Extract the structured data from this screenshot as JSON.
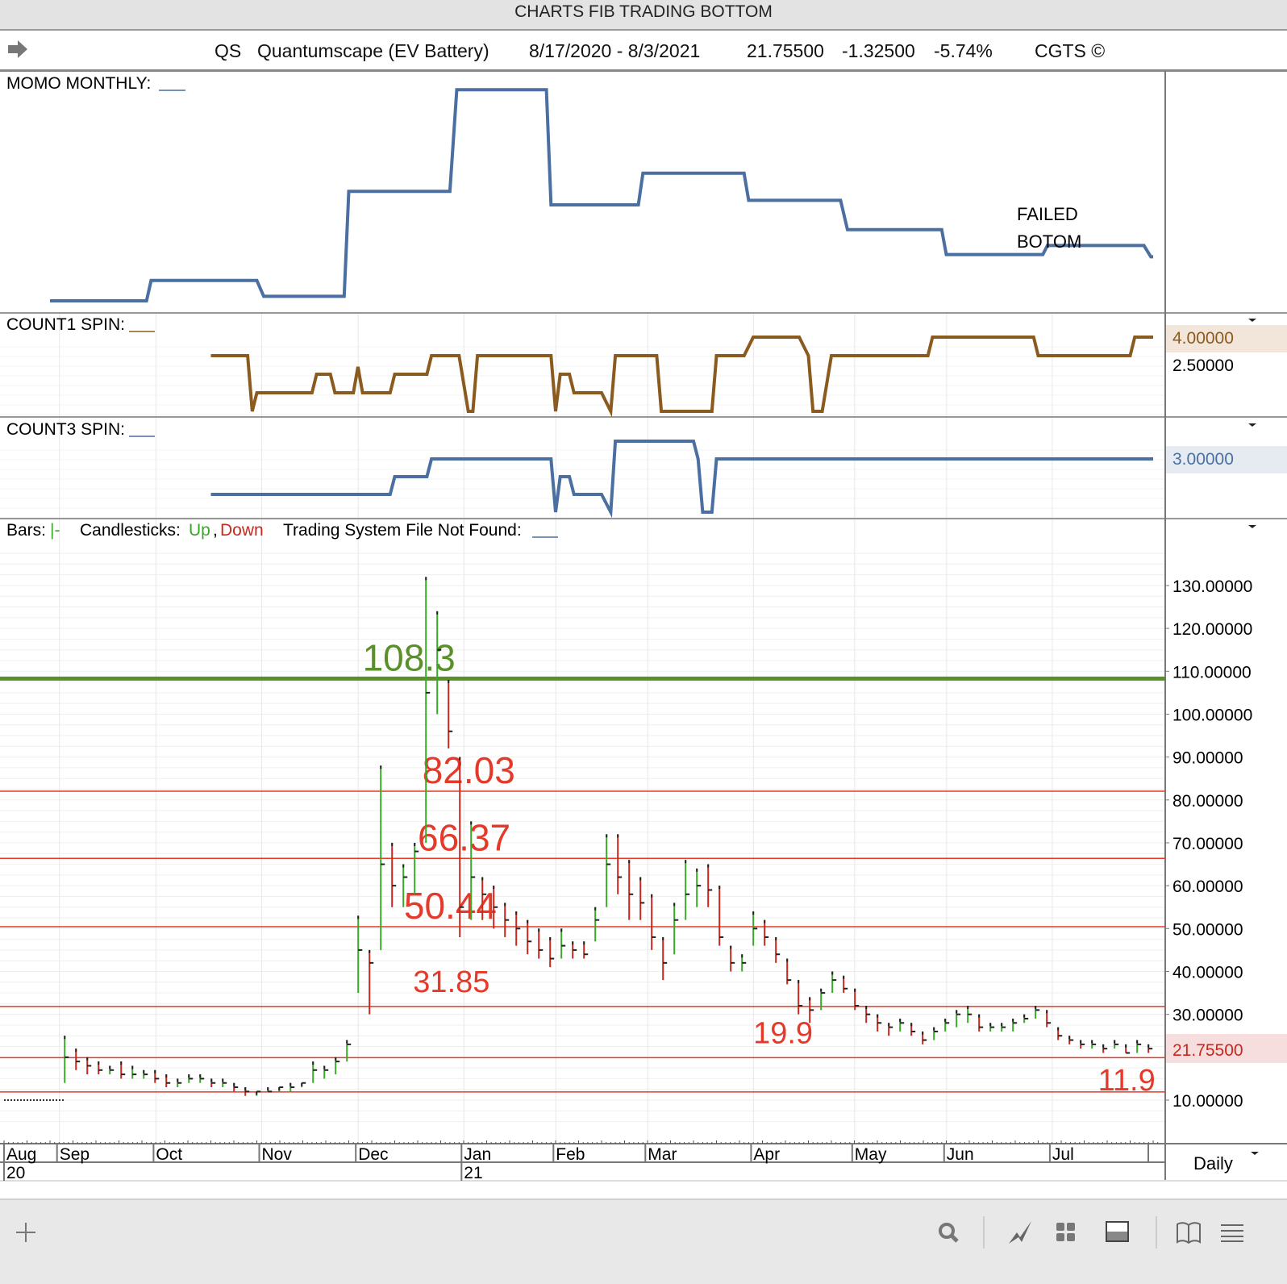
{
  "window_title": "CHARTS FIB TRADING BOTTOM",
  "info": {
    "symbol": "QS",
    "name": "Quantumscape (EV Battery)",
    "date_range": "8/17/2020 - 8/3/2021",
    "last": "21.75500",
    "change": "-1.32500",
    "change_pct": "-5.74%",
    "copyright": "CGTS ©"
  },
  "panels": {
    "momo": {
      "label": "MOMO MONTHLY:",
      "annotation_1": "FAILED",
      "annotation_2": "BOTOM",
      "color": "#4a6fa0"
    },
    "count1": {
      "label": "COUNT1 SPIN:",
      "axis_top": "4.00000",
      "axis_mid": "2.50000",
      "color": "#8b5a1e"
    },
    "count3": {
      "label": "COUNT3 SPIN:",
      "axis_top": "3.00000",
      "color": "#4a6fa0"
    },
    "price": {
      "bars_label": "Bars:",
      "bars_marker": "|-",
      "candles_label": "Candlesticks:",
      "up": "Up",
      "comma": ",",
      "down": "Down",
      "system_label": "Trading System File Not Found:",
      "current_price": "21.75500",
      "period": "Daily"
    }
  },
  "colors": {
    "up": "#3aa829",
    "down": "#c8281e",
    "fib_red": "#e53a2a",
    "fib_green": "#5a8f2a",
    "line_blue": "#4a6fa0",
    "line_brown": "#8b5a1e"
  },
  "chart_data": {
    "type": "bar",
    "x_unit": "trading day since 8/17/2020",
    "x_range": [
      0,
      252
    ],
    "price_ylim": [
      0,
      140
    ],
    "price_ticks": [
      "130.00000",
      "120.00000",
      "110.00000",
      "100.00000",
      "90.00000",
      "80.00000",
      "70.00000",
      "60.00000",
      "50.00000",
      "40.00000",
      "30.00000",
      "10.00000"
    ],
    "price_tick_values": [
      130,
      120,
      110,
      100,
      90,
      80,
      70,
      60,
      50,
      40,
      30,
      10
    ],
    "months": [
      {
        "label": "Aug",
        "year": "20",
        "day": 0
      },
      {
        "label": "Sep",
        "day": 11
      },
      {
        "label": "Oct",
        "day": 32
      },
      {
        "label": "Nov",
        "day": 55
      },
      {
        "label": "Dec",
        "day": 76
      },
      {
        "label": "Jan",
        "year": "21",
        "day": 99
      },
      {
        "label": "Feb",
        "day": 119
      },
      {
        "label": "Mar",
        "day": 139
      },
      {
        "label": "Apr",
        "day": 162
      },
      {
        "label": "May",
        "day": 184
      },
      {
        "label": "Jun",
        "day": 204
      },
      {
        "label": "Jul",
        "day": 227
      }
    ],
    "pre_listing_price": 10,
    "pre_listing_days": [
      0,
      13
    ],
    "bars_start_day": 13.2,
    "bars_step_days": 2.456,
    "bars_hlc": [
      [
        25,
        14,
        20
      ],
      [
        22,
        17,
        19
      ],
      [
        20,
        16,
        18
      ],
      [
        19,
        16,
        17
      ],
      [
        18,
        16,
        17
      ],
      [
        19,
        15,
        16
      ],
      [
        18,
        15,
        16
      ],
      [
        17,
        15,
        16
      ],
      [
        17,
        14,
        15
      ],
      [
        16,
        13,
        14
      ],
      [
        15,
        13,
        14
      ],
      [
        16,
        14,
        15
      ],
      [
        16,
        14,
        15
      ],
      [
        15,
        13,
        14
      ],
      [
        15,
        13,
        14
      ],
      [
        14,
        12,
        13
      ],
      [
        13,
        11,
        12
      ],
      [
        12,
        11,
        12
      ],
      [
        13,
        12,
        12
      ],
      [
        13,
        12,
        13
      ],
      [
        14,
        12,
        13
      ],
      [
        14,
        13,
        14
      ],
      [
        19,
        14,
        17
      ],
      [
        18,
        15,
        17
      ],
      [
        20,
        16,
        19
      ],
      [
        24,
        19,
        23
      ],
      [
        53,
        35,
        45
      ],
      [
        45,
        30,
        42
      ],
      [
        88,
        45,
        65
      ],
      [
        70,
        55,
        60
      ],
      [
        65,
        55,
        62
      ],
      [
        70,
        58,
        68
      ],
      [
        132,
        70,
        105
      ],
      [
        124,
        100,
        115
      ],
      [
        108,
        92,
        96
      ],
      [
        90,
        48,
        55
      ],
      [
        75,
        52,
        62
      ],
      [
        62,
        52,
        58
      ],
      [
        60,
        50,
        55
      ],
      [
        56,
        48,
        52
      ],
      [
        54,
        46,
        50
      ],
      [
        52,
        44,
        47
      ],
      [
        50,
        43,
        45
      ],
      [
        48,
        41,
        43
      ],
      [
        50,
        43,
        46
      ],
      [
        47,
        43,
        45
      ],
      [
        47,
        43,
        44
      ],
      [
        55,
        47,
        52
      ],
      [
        72,
        55,
        65
      ],
      [
        72,
        58,
        62
      ],
      [
        66,
        52,
        58
      ],
      [
        62,
        52,
        56
      ],
      [
        58,
        45,
        48
      ],
      [
        48,
        38,
        42
      ],
      [
        56,
        44,
        52
      ],
      [
        66,
        52,
        58
      ],
      [
        64,
        55,
        60
      ],
      [
        65,
        55,
        59
      ],
      [
        60,
        46,
        48
      ],
      [
        46,
        40,
        42
      ],
      [
        44,
        40,
        42
      ],
      [
        54,
        46,
        50
      ],
      [
        52,
        46,
        48
      ],
      [
        48,
        42,
        44
      ],
      [
        43,
        37,
        38
      ],
      [
        38,
        30,
        32
      ],
      [
        34,
        28,
        31
      ],
      [
        36,
        31,
        35
      ],
      [
        40,
        35,
        38
      ],
      [
        39,
        35,
        36
      ],
      [
        36,
        31,
        32
      ],
      [
        32,
        28,
        30
      ],
      [
        30,
        26,
        28
      ],
      [
        28,
        25,
        27
      ],
      [
        29,
        26,
        28
      ],
      [
        28,
        25,
        26
      ],
      [
        26,
        23,
        24
      ],
      [
        27,
        24,
        26
      ],
      [
        29,
        26,
        28
      ],
      [
        31,
        27,
        30
      ],
      [
        32,
        28,
        30
      ],
      [
        30,
        26,
        27
      ],
      [
        28,
        26,
        27
      ],
      [
        28,
        26,
        27
      ],
      [
        29,
        26,
        28
      ],
      [
        30,
        28,
        29
      ],
      [
        32,
        29,
        31
      ],
      [
        31,
        27,
        28
      ],
      [
        27,
        24,
        25
      ],
      [
        25,
        23,
        24
      ],
      [
        24,
        22,
        23
      ],
      [
        24,
        22,
        23
      ],
      [
        23,
        21,
        22
      ],
      [
        24,
        22,
        23
      ],
      [
        23,
        21,
        21
      ],
      [
        24,
        21,
        23
      ],
      [
        23,
        21,
        22
      ]
    ],
    "fib_levels": [
      {
        "label": "108.3",
        "value": 108.3,
        "color": "green",
        "label_day": 78
      },
      {
        "label": "82.03",
        "value": 82.03,
        "color": "red",
        "label_day": 91
      },
      {
        "label": "66.37",
        "value": 66.37,
        "color": "red",
        "label_day": 90
      },
      {
        "label": "50.44",
        "value": 50.44,
        "color": "red",
        "label_day": 87
      },
      {
        "label": "31.85",
        "value": 31.85,
        "color": "red",
        "label_day": 89
      },
      {
        "label": "19.9",
        "value": 19.9,
        "color": "red",
        "label_day": 163
      },
      {
        "label": "11.9",
        "value": 11.9,
        "color": "red",
        "label_day": 238
      }
    ],
    "momo_points": [
      [
        10,
        0.25
      ],
      [
        31,
        0.25
      ],
      [
        32,
        1.15
      ],
      [
        55,
        1.15
      ],
      [
        56.5,
        0.45
      ],
      [
        74,
        0.45
      ],
      [
        75,
        5.1
      ],
      [
        97,
        5.1
      ],
      [
        98.5,
        9.6
      ],
      [
        118,
        9.6
      ],
      [
        119,
        4.5
      ],
      [
        138,
        4.5
      ],
      [
        139,
        5.9
      ],
      [
        161,
        5.9
      ],
      [
        162,
        4.7
      ],
      [
        182,
        4.7
      ],
      [
        183.5,
        3.4
      ],
      [
        204,
        3.4
      ],
      [
        205,
        2.3
      ],
      [
        226,
        2.3
      ],
      [
        227,
        2.7
      ],
      [
        248,
        2.7
      ],
      [
        249.5,
        2.2
      ],
      [
        250,
        2.2
      ]
    ],
    "count1_points": [
      [
        45,
        3
      ],
      [
        53,
        3
      ],
      [
        54,
        0
      ],
      [
        55,
        1
      ],
      [
        67,
        1
      ],
      [
        68,
        2
      ],
      [
        71,
        2
      ],
      [
        72,
        1
      ],
      [
        76,
        1
      ],
      [
        77,
        2.4
      ],
      [
        78,
        1
      ],
      [
        84,
        1
      ],
      [
        85,
        2
      ],
      [
        92,
        2
      ],
      [
        93,
        3
      ],
      [
        99,
        3
      ],
      [
        101,
        0
      ],
      [
        102,
        0
      ],
      [
        103,
        3
      ],
      [
        119,
        3
      ],
      [
        120,
        0
      ],
      [
        121,
        2
      ],
      [
        123,
        2
      ],
      [
        124,
        1
      ],
      [
        130,
        1
      ],
      [
        132,
        0
      ],
      [
        133,
        3
      ],
      [
        142,
        3
      ],
      [
        143,
        0
      ],
      [
        154,
        0
      ],
      [
        155,
        3
      ],
      [
        161,
        3
      ],
      [
        163,
        4
      ],
      [
        173,
        4
      ],
      [
        175,
        3
      ],
      [
        176,
        0
      ],
      [
        178,
        0
      ],
      [
        180,
        3
      ],
      [
        201,
        3
      ],
      [
        202,
        4
      ],
      [
        224,
        4
      ],
      [
        225,
        3
      ],
      [
        245,
        3
      ],
      [
        246,
        4
      ],
      [
        250,
        4
      ]
    ],
    "count3_points": [
      [
        45,
        1
      ],
      [
        84,
        1
      ],
      [
        85,
        2
      ],
      [
        92,
        2
      ],
      [
        93,
        3
      ],
      [
        119,
        3
      ],
      [
        120,
        0
      ],
      [
        121,
        2
      ],
      [
        123,
        2
      ],
      [
        124,
        1
      ],
      [
        130,
        1
      ],
      [
        132,
        0
      ],
      [
        133,
        4
      ],
      [
        150,
        4
      ],
      [
        151,
        3
      ],
      [
        152,
        0
      ],
      [
        154,
        0
      ],
      [
        155,
        3
      ],
      [
        250,
        3
      ]
    ]
  },
  "toolbar": {
    "add": "add",
    "search": "search",
    "draw": "draw",
    "layout": "layout",
    "panel": "panel",
    "book": "book",
    "menu": "menu"
  }
}
